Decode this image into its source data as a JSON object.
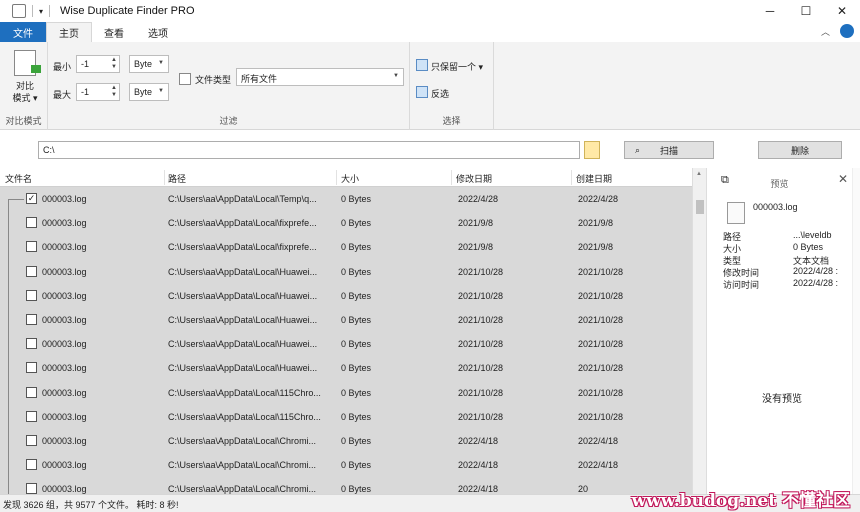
{
  "window": {
    "title": "Wise Duplicate Finder PRO",
    "controls": {
      "minimize": "─",
      "maximize": "☐",
      "close": "✕"
    }
  },
  "ribbon_tabs": [
    {
      "label": "文件"
    },
    {
      "label": "主页"
    },
    {
      "label": "查看"
    },
    {
      "label": "选项"
    }
  ],
  "ribbon": {
    "compare": {
      "label_line1": "对比",
      "label_line2": "模式 ▾",
      "group": "对比模式"
    },
    "filter": {
      "min_label": "最小",
      "min_value": "-1",
      "min_unit": "Byte",
      "max_label": "最大",
      "max_value": "-1",
      "max_unit": "Byte",
      "filetype_label": "文件类型",
      "filetype_value": "所有文件",
      "group": "过滤"
    },
    "select": {
      "keep_one": "只保留一个 ▾",
      "invert": "反选",
      "group": "选择"
    }
  },
  "pathbar": {
    "path": "C:\\",
    "scan_label": "扫描",
    "delete_label": "删除"
  },
  "table": {
    "headers": [
      "文件名",
      "路径",
      "大小",
      "修改日期",
      "创建日期"
    ],
    "rows": [
      {
        "name": "000003.log",
        "path": "C:\\Users\\aa\\AppData\\Local\\Temp\\q...",
        "size": "0 Bytes",
        "modified": "2022/4/28",
        "created": "2022/4/28",
        "checked": true
      },
      {
        "name": "000003.log",
        "path": "C:\\Users\\aa\\AppData\\Local\\fixprefe...",
        "size": "0 Bytes",
        "modified": "2021/9/8",
        "created": "2021/9/8",
        "checked": false
      },
      {
        "name": "000003.log",
        "path": "C:\\Users\\aa\\AppData\\Local\\fixprefe...",
        "size": "0 Bytes",
        "modified": "2021/9/8",
        "created": "2021/9/8",
        "checked": false
      },
      {
        "name": "000003.log",
        "path": "C:\\Users\\aa\\AppData\\Local\\Huawei...",
        "size": "0 Bytes",
        "modified": "2021/10/28",
        "created": "2021/10/28",
        "checked": false
      },
      {
        "name": "000003.log",
        "path": "C:\\Users\\aa\\AppData\\Local\\Huawei...",
        "size": "0 Bytes",
        "modified": "2021/10/28",
        "created": "2021/10/28",
        "checked": false
      },
      {
        "name": "000003.log",
        "path": "C:\\Users\\aa\\AppData\\Local\\Huawei...",
        "size": "0 Bytes",
        "modified": "2021/10/28",
        "created": "2021/10/28",
        "checked": false
      },
      {
        "name": "000003.log",
        "path": "C:\\Users\\aa\\AppData\\Local\\Huawei...",
        "size": "0 Bytes",
        "modified": "2021/10/28",
        "created": "2021/10/28",
        "checked": false
      },
      {
        "name": "000003.log",
        "path": "C:\\Users\\aa\\AppData\\Local\\Huawei...",
        "size": "0 Bytes",
        "modified": "2021/10/28",
        "created": "2021/10/28",
        "checked": false
      },
      {
        "name": "000003.log",
        "path": "C:\\Users\\aa\\AppData\\Local\\115Chro...",
        "size": "0 Bytes",
        "modified": "2021/10/28",
        "created": "2021/10/28",
        "checked": false
      },
      {
        "name": "000003.log",
        "path": "C:\\Users\\aa\\AppData\\Local\\115Chro...",
        "size": "0 Bytes",
        "modified": "2021/10/28",
        "created": "2021/10/28",
        "checked": false
      },
      {
        "name": "000003.log",
        "path": "C:\\Users\\aa\\AppData\\Local\\Chromi...",
        "size": "0 Bytes",
        "modified": "2022/4/18",
        "created": "2022/4/18",
        "checked": false
      },
      {
        "name": "000003.log",
        "path": "C:\\Users\\aa\\AppData\\Local\\Chromi...",
        "size": "0 Bytes",
        "modified": "2022/4/18",
        "created": "2022/4/18",
        "checked": false
      },
      {
        "name": "000003.log",
        "path": "C:\\Users\\aa\\AppData\\Local\\Chromi...",
        "size": "0 Bytes",
        "modified": "2022/4/18",
        "created": "20",
        "checked": false
      }
    ]
  },
  "preview": {
    "title": "预览",
    "filename": "000003.log",
    "fields": [
      {
        "k": "路径",
        "v": "...\\leveldb"
      },
      {
        "k": "大小",
        "v": "0 Bytes"
      },
      {
        "k": "类型",
        "v": "文本文档"
      },
      {
        "k": "修改时间",
        "v": "2022/4/28 :"
      },
      {
        "k": "访问时间",
        "v": "2022/4/28 :"
      }
    ],
    "empty_text": "没有预览"
  },
  "status": {
    "text": "发现 3626 组，共 9577 个文件。 耗时: 8 秒!"
  },
  "watermark": "www.budog.net 不懂社区",
  "colors": {
    "file_tab": "#1e6fbf",
    "table_bg": "#d9d9d9",
    "watermark": "#c2185b"
  }
}
